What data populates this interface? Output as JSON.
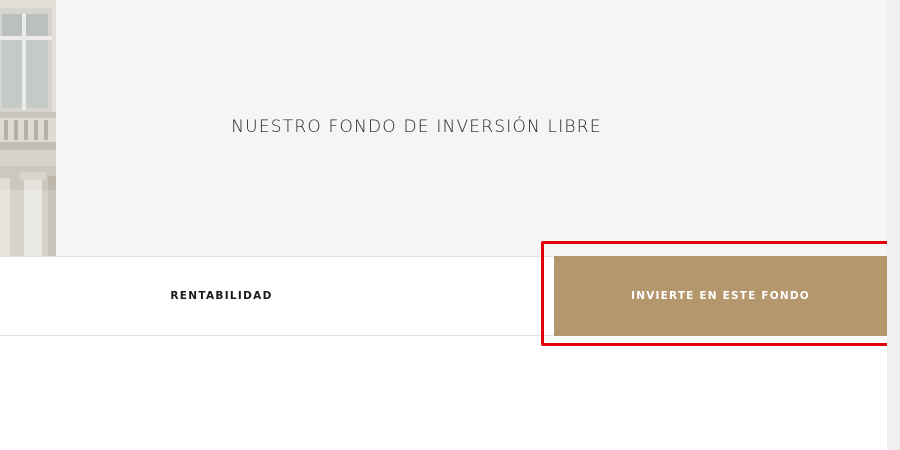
{
  "hero": {
    "title": "NUESTRO FONDO DE INVERSIÓN LIBRE"
  },
  "tabs": {
    "rentabilidad_label": "RENTABILIDAD"
  },
  "cta": {
    "label": "INVIERTE EN ESTE FONDO"
  },
  "colors": {
    "accent": "#b4976c",
    "highlight": "#e3000b",
    "hero_background": "#f5f5f5"
  }
}
